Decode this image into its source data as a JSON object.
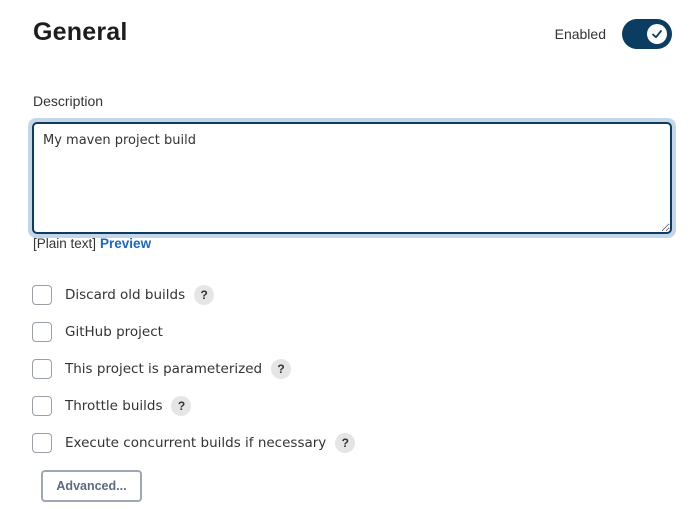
{
  "section": {
    "title": "General"
  },
  "enabled": {
    "label": "Enabled",
    "state": true
  },
  "description": {
    "label": "Description",
    "value": "My maven project build"
  },
  "format": {
    "plain_text": "[Plain text]",
    "preview_link": "Preview"
  },
  "options": [
    {
      "label": "Discard old builds",
      "checked": false,
      "has_help": true
    },
    {
      "label": "GitHub project",
      "checked": false,
      "has_help": false
    },
    {
      "label": "This project is parameterized",
      "checked": false,
      "has_help": true
    },
    {
      "label": "Throttle builds",
      "checked": false,
      "has_help": true
    },
    {
      "label": "Execute concurrent builds if necessary",
      "checked": false,
      "has_help": true
    }
  ],
  "help_glyph": "?",
  "advanced_button": {
    "label": "Advanced..."
  },
  "colors": {
    "accent": "#0b3d62",
    "link": "#1a66c9",
    "focus_ring": "#c4d6e8"
  },
  "icons": {
    "toggle_check": "checkmark-icon",
    "help": "help-icon"
  }
}
